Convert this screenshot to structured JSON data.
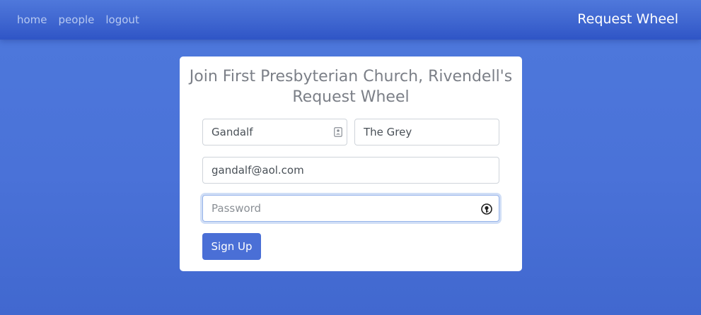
{
  "nav": {
    "links": [
      "home",
      "people",
      "logout"
    ],
    "brand": "Request Wheel"
  },
  "form": {
    "title": "Join First Presbyterian Church, Rivendell's Request Wheel",
    "first_name": {
      "value": "Gandalf",
      "placeholder": "",
      "icon": "contact-card-icon"
    },
    "last_name": {
      "value": "The Grey",
      "placeholder": ""
    },
    "email": {
      "value": "gandalf@aol.com",
      "placeholder": ""
    },
    "password": {
      "value": "",
      "placeholder": "Password",
      "icon": "password-key-icon",
      "focused": true
    },
    "submit_label": "Sign Up"
  },
  "colors": {
    "accent": "#4a6fd6",
    "navbar": "#3f66d0",
    "page_background": "#4a72d8",
    "nav_link": "#b7c9f1",
    "title_text": "#7b7f87"
  }
}
